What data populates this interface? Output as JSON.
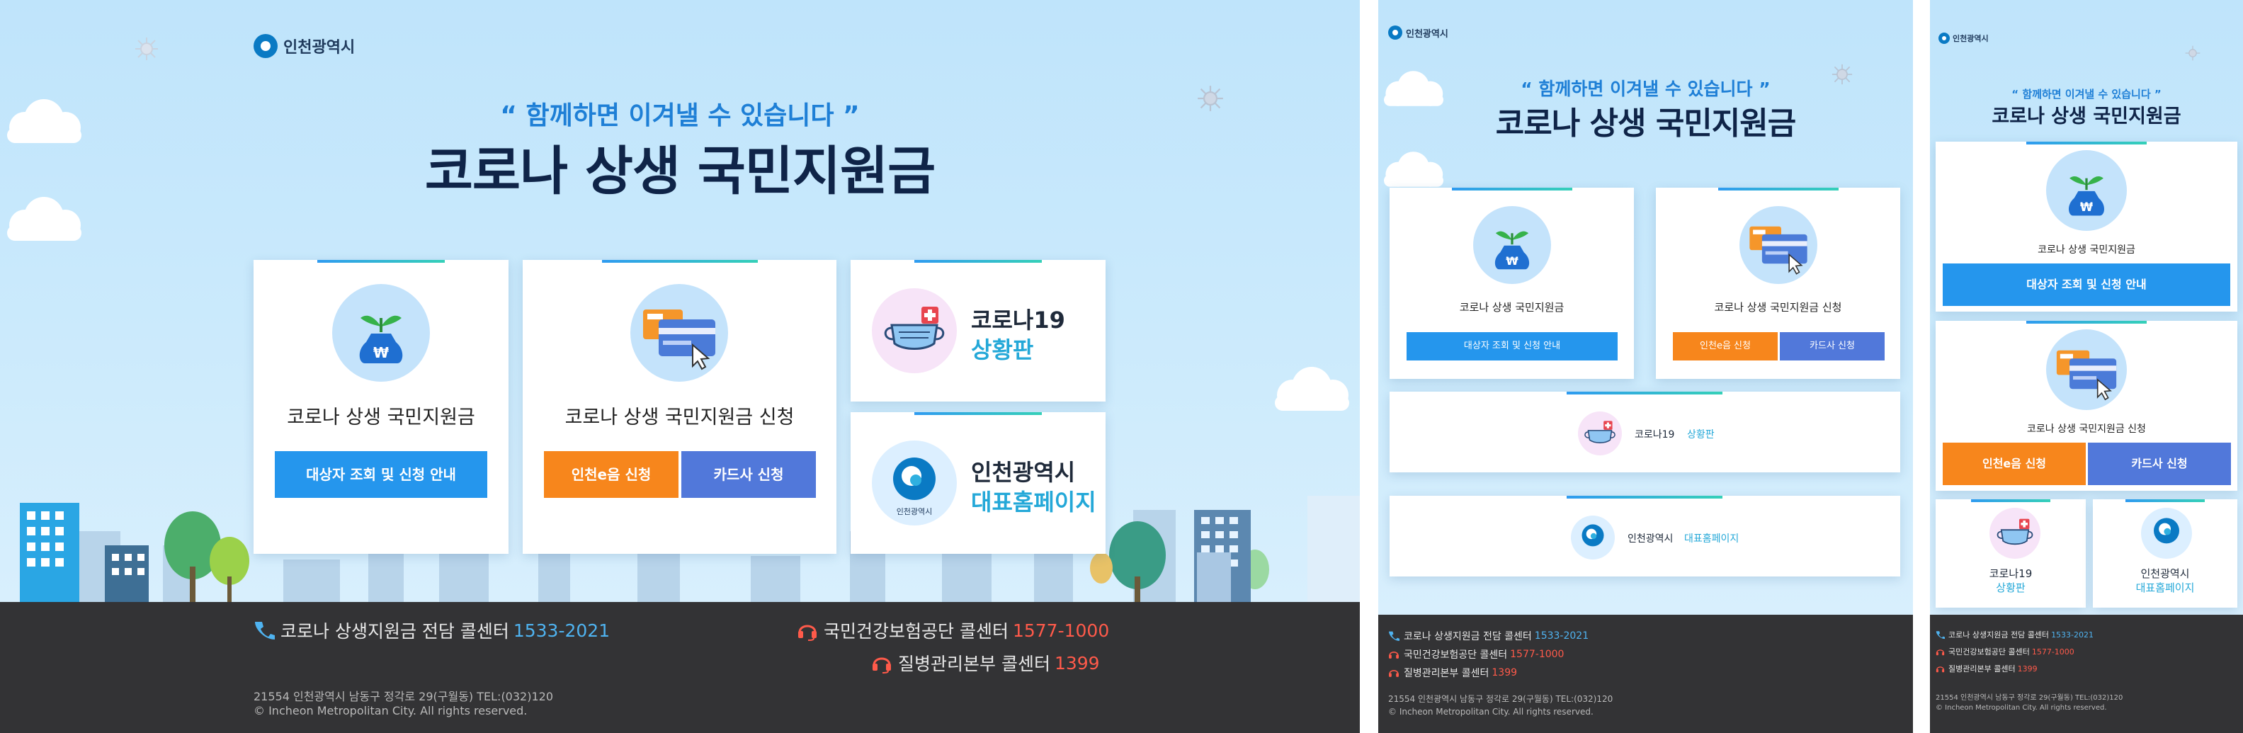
{
  "brand": {
    "logo_text": "인천광역시"
  },
  "hero": {
    "slogan": "“ 함께하면 이겨낼 수 있습니다 ”",
    "title": "코로나 상생 국민지원금"
  },
  "cards": {
    "info": {
      "title": "코로나 상생 국민지원금",
      "button": "대상자 조회 및 신청 안내"
    },
    "apply": {
      "title": "코로나 상생 국민지원금 신청",
      "button_incheon": "인천e음 신청",
      "button_card": "카드사 신청"
    },
    "status": {
      "line1": "코로나19",
      "line2": "상황판"
    },
    "homepage": {
      "line1": "인천광역시",
      "line2": "대표홈페이지",
      "seal_text": "인천광역시"
    }
  },
  "footer": {
    "call1_label": "코로나 상생지원금 전담 콜센터",
    "call1_number": "1533-2021",
    "call2_label": "국민건강보험공단 콜센터",
    "call2_number": "1577-1000",
    "call3_label": "질병관리본부 콜센터",
    "call3_number": "1399",
    "address": "21554 인천광역시 남동구 정각로 29(구월동) TEL:(032)120",
    "copyright": "© Incheon Metropolitan City. All rights reserved."
  },
  "colors": {
    "sky": "#bfe4fb",
    "title_navy": "#0f2448",
    "slogan_blue": "#1e7fd6",
    "button_blue": "#2596ed",
    "button_orange": "#f7861c",
    "button_indigo": "#5178da",
    "footer_bg": "#333335",
    "number_blue": "#4fb3f0",
    "number_red": "#ff5a4a"
  },
  "icons": [
    "incheon-logo-icon",
    "money-bag-sprout-icon",
    "card-cursor-icon",
    "mask-icon",
    "incheon-seal-icon",
    "phone-icon",
    "headset-icon",
    "cloud-icon",
    "virus-icon",
    "city-skyline-icon"
  ]
}
